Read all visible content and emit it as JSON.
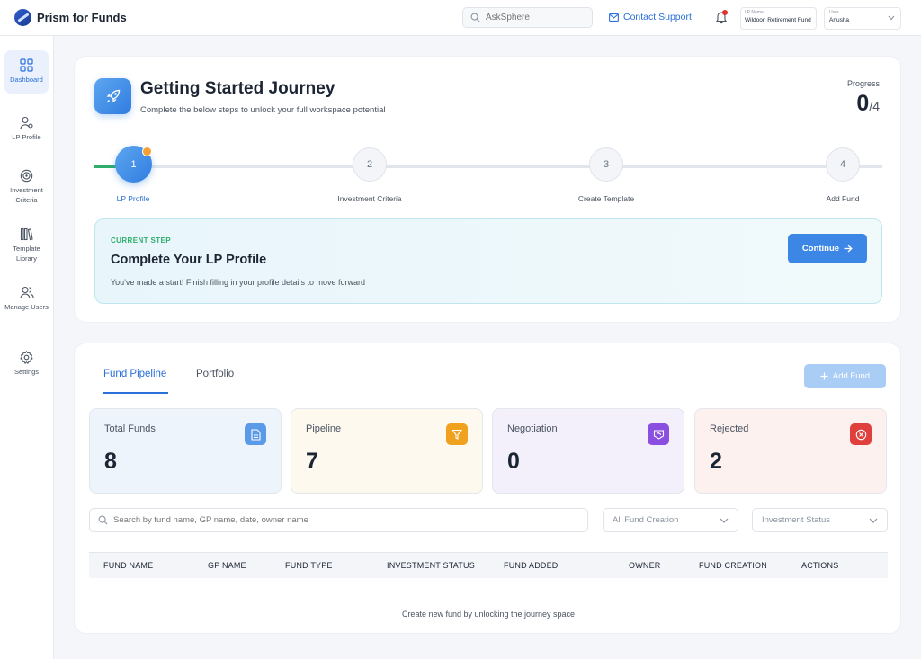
{
  "app": {
    "name": "Prism for Funds"
  },
  "topbar": {
    "search_placeholder": "AskSphere",
    "contact_label": "Contact Support",
    "lp_name_label": "LP Name",
    "lp_name_value": "Wildoon Retirement Fund",
    "user_label": "User",
    "user_value": "Anusha"
  },
  "sidebar": {
    "items": [
      {
        "label": "Dashboard",
        "icon": "grid-icon"
      },
      {
        "label": "LP Profile",
        "icon": "user-settings-icon"
      },
      {
        "label": "Investment Criteria",
        "icon": "target-icon"
      },
      {
        "label": "Template Library",
        "icon": "library-icon"
      },
      {
        "label": "Manage Users",
        "icon": "users-icon"
      },
      {
        "label": "Settings",
        "icon": "gear-icon"
      }
    ]
  },
  "journey": {
    "title": "Getting Started Journey",
    "subtitle": "Complete the below steps to unlock your full workspace potential",
    "progress_label": "Progress",
    "progress_done": "0",
    "progress_total": "/4",
    "steps": [
      {
        "number": "1",
        "label": "LP Profile"
      },
      {
        "number": "2",
        "label": "Investment Criteria"
      },
      {
        "number": "3",
        "label": "Create Template"
      },
      {
        "number": "4",
        "label": "Add Fund"
      }
    ],
    "current": {
      "tag": "CURRENT STEP",
      "title": "Complete Your LP Profile",
      "description": "You've made a start! Finish filling in your profile details to move forward",
      "button": "Continue"
    }
  },
  "funds": {
    "tabs": [
      "Fund Pipeline",
      "Portfolio"
    ],
    "add_button": "Add Fund",
    "stats": [
      {
        "label": "Total Funds",
        "value": "8",
        "icon": "document-icon",
        "color": "#5b9ae8",
        "bg": "#eef4fc"
      },
      {
        "label": "Pipeline",
        "value": "7",
        "icon": "filter-icon",
        "color": "#f0a21e",
        "bg": "#fdf9ee"
      },
      {
        "label": "Negotiation",
        "value": "0",
        "icon": "handshake-icon",
        "color": "#8a4fe0",
        "bg": "#f3f0fc"
      },
      {
        "label": "Rejected",
        "value": "2",
        "icon": "close-circle-icon",
        "color": "#e0403b",
        "bg": "#fdf1f0"
      }
    ],
    "search_placeholder": "Search by fund name, GP name, date, owner name",
    "filter_creation": "All Fund Creation",
    "filter_status": "Investment Status",
    "columns": [
      "FUND NAME",
      "GP NAME",
      "FUND TYPE",
      "INVESTMENT STATUS",
      "FUND ADDED",
      "OWNER",
      "FUND CREATION",
      "ACTIONS"
    ],
    "empty_message": "Create new fund by unlocking the journey space"
  }
}
